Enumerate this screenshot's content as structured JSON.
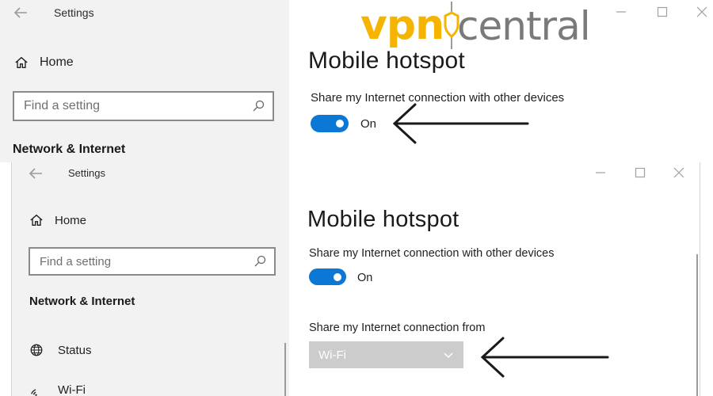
{
  "top_window": {
    "titlebar": {
      "title": "Settings"
    },
    "sidebar": {
      "home_label": "Home",
      "search_placeholder": "Find a setting",
      "section_heading": "Network & Internet"
    },
    "content": {
      "page_title": "Mobile hotspot",
      "share_label": "Share my Internet connection with other devices",
      "toggle_state": "On",
      "toggle_on": true
    }
  },
  "bottom_window": {
    "titlebar": {
      "title": "Settings"
    },
    "sidebar": {
      "home_label": "Home",
      "search_placeholder": "Find a setting",
      "section_heading": "Network & Internet",
      "items": [
        {
          "label": "Status",
          "icon": "globe-icon"
        },
        {
          "label": "Wi-Fi",
          "icon": "wifi-icon"
        }
      ]
    },
    "content": {
      "page_title": "Mobile hotspot",
      "share_label": "Share my Internet connection with other devices",
      "toggle_state": "On",
      "toggle_on": true,
      "share_from_label": "Share my Internet connection from",
      "share_from_value": "Wi-Fi"
    }
  },
  "watermark": {
    "part1": "vpn",
    "part2": "central"
  },
  "colors": {
    "accent": "#0a78d4",
    "logo_yellow": "#f5b400",
    "logo_gray": "#7a7a7a"
  }
}
